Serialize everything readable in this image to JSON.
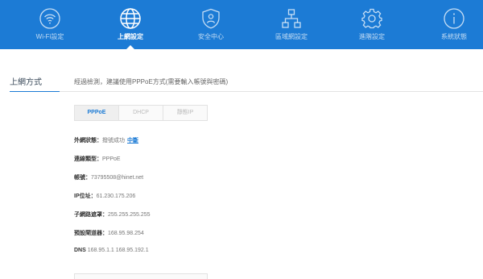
{
  "nav": {
    "items": [
      {
        "label": "Wi-Fi設定",
        "icon": "wifi-icon"
      },
      {
        "label": "上網設定",
        "icon": "globe-icon"
      },
      {
        "label": "安全中心",
        "icon": "shield-icon"
      },
      {
        "label": "區域網設定",
        "icon": "network-icon"
      },
      {
        "label": "進階設定",
        "icon": "gear-icon"
      },
      {
        "label": "系統狀態",
        "icon": "info-icon"
      }
    ],
    "active": "上網設定"
  },
  "section": {
    "title": "上網方式",
    "description": "經過檢測，建議使用PPPoE方式(需要輸入帳號與密碼)"
  },
  "tabs": [
    "PPPoE",
    "DHCP",
    "靜態IP"
  ],
  "active_tab": "PPPoE",
  "info": {
    "status_label": "外網狀態：",
    "status_value": "撥號成功",
    "disconnect_label": "中斷",
    "conn_type_label": "連線類型：",
    "conn_type_value": "PPPoE",
    "account_label": "帳號：",
    "account_value": "73795508@hinet.net",
    "ip_label": "IP位址：",
    "ip_value": "61.230.175.206",
    "mask_label": "子網路遮罩：",
    "mask_value": "255.255.255.255",
    "gateway_label": "預設閘道器：",
    "gateway_value": "168.95.98.254",
    "dns_label": "DNS",
    "dns_value": "168.95.1.1 168.95.192.1"
  },
  "colors": {
    "accent": "#1c7bd5",
    "nav_bg": "#1c7bd5"
  }
}
